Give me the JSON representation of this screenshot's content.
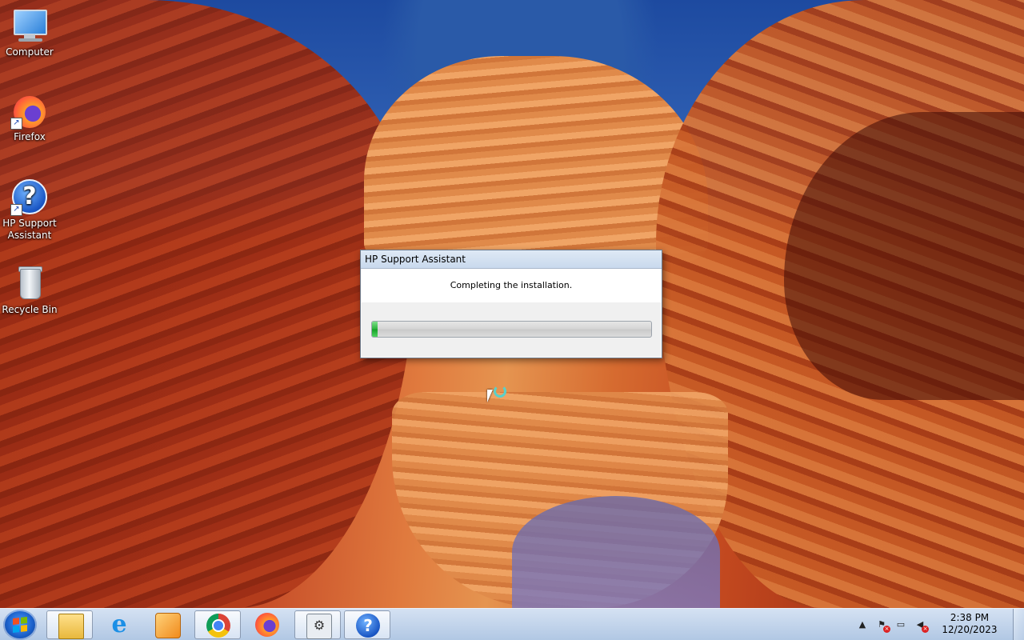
{
  "desktop": {
    "icons": [
      {
        "label": "Computer",
        "icon": "computer-icon"
      },
      {
        "label": "Firefox",
        "icon": "firefox-icon"
      },
      {
        "label": "HP Support Assistant",
        "icon": "hp-support-assistant-icon"
      },
      {
        "label": "Recycle Bin",
        "icon": "recycle-bin-icon"
      }
    ]
  },
  "dialog": {
    "title": "HP Support Assistant",
    "message": "Completing the installation.",
    "progress": 0.02,
    "progress_color": "#22b033"
  },
  "taskbar": {
    "start_icon": "windows-start-icon",
    "pinned": [
      {
        "icon": "file-explorer-icon",
        "active": true
      },
      {
        "icon": "internet-explorer-icon",
        "active": false
      },
      {
        "icon": "windows-media-player-icon",
        "active": false
      },
      {
        "icon": "chrome-icon",
        "active": true
      },
      {
        "icon": "firefox-icon",
        "active": false
      },
      {
        "icon": "installer-icon",
        "active": true
      },
      {
        "icon": "hp-support-assistant-icon",
        "active": true
      }
    ],
    "tray": {
      "icons": [
        "show-hidden-icons-icon",
        "action-center-flag-icon",
        "network-icon",
        "volume-muted-icon"
      ],
      "time": "2:38 PM",
      "date": "12/20/2023"
    }
  }
}
